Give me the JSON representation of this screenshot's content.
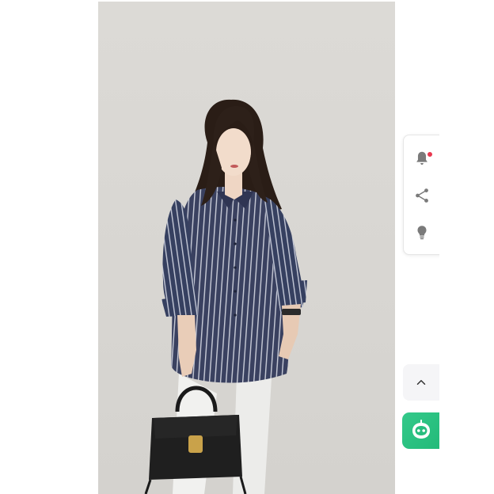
{
  "product_photo": {
    "alt": "",
    "background_color": "#d9d7d3",
    "shirt_color": "#3a4160",
    "pants_color": "#f2f2f0",
    "bag_color": "#1f1f1f"
  },
  "toolbar": {
    "items": [
      {
        "icon": "bell-icon",
        "has_notification": true
      },
      {
        "icon": "share-icon"
      },
      {
        "icon": "lightbulb-icon"
      }
    ]
  },
  "back_to_top": {
    "icon": "chevron-up-icon"
  },
  "assistant": {
    "icon": "robot-icon",
    "color": "#27bd7e"
  }
}
